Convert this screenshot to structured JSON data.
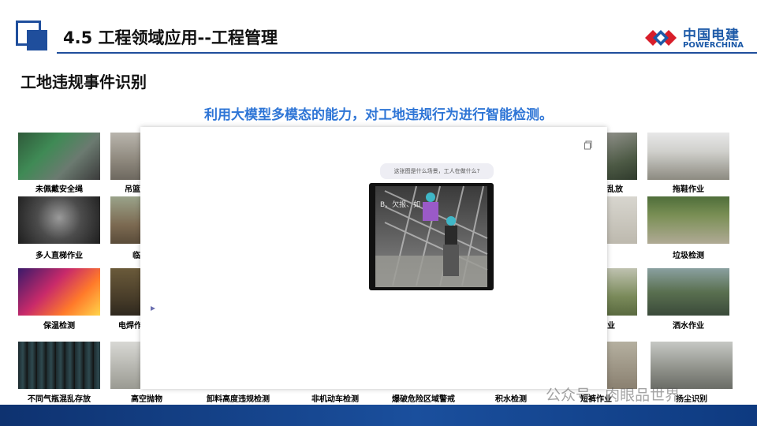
{
  "header": {
    "slide_title": "4.5 工程领域应用--工程管理",
    "brand_cn": "中国电建",
    "brand_en": "POWERCHINA",
    "section_title": "工地违规事件识别",
    "subtitle": "利用大模型多模态的能力，对工地违规行为进行智能检测。"
  },
  "tiles": {
    "r1c1": "未佩戴安全绳",
    "r1c2": "吊篮",
    "r1c8": "乱放",
    "r1c9": "拖鞋作业",
    "r2c1": "多人直梯作业",
    "r2c2": "临",
    "r2c9": "垃圾检测",
    "r3c1": "保温检测",
    "r3c2": "电焊作",
    "r3c8": "业",
    "r3c9": "洒水作业",
    "r4c1": "不同气瓶混乱存放",
    "r4c2": "高空抛物",
    "r4c3": "卸料高度违规检测",
    "r4c4": "非机动车检测",
    "r4c5": "爆破危险区域警戒",
    "r4c6": "积水检测",
    "r4c8": "短裤作业",
    "r4c9": "扬尘识别"
  },
  "overlay": {
    "prompt": "这张图是什么场景，工人在做什么?",
    "photo_text": "B、欠报、如"
  },
  "watermark": "公众号 · 肉眼品世界",
  "colors": {
    "brand_blue": "#1f4e9c",
    "subtitle_blue": "#2e75d6",
    "footer_blue": "#0e3270"
  }
}
